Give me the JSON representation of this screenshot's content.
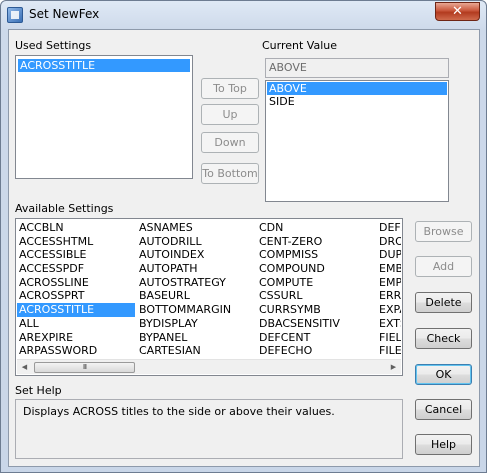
{
  "window": {
    "title": "Set NewFex",
    "close_glyph": "✕"
  },
  "used_settings": {
    "label": "Used Settings",
    "items": [
      "ACROSSTITLE"
    ]
  },
  "move_buttons": {
    "to_top": "To Top",
    "up": "Up",
    "down": "Down",
    "to_bottom": "To Bottom"
  },
  "current_value": {
    "label": "Current Value",
    "field_value": "ABOVE",
    "options": [
      "ABOVE",
      "SIDE"
    ]
  },
  "available_settings": {
    "label": "Available Settings",
    "columns": [
      [
        "ACCBLN",
        "ACCESSHTML",
        "ACCESSIBLE",
        "ACCESSPDF",
        "ACROSSLINE",
        "ACROSSPRT",
        "ACROSSTITLE",
        "ALL",
        "AREXPIRE",
        "ARPASSWORD"
      ],
      [
        "ASNAMES",
        "AUTODRILL",
        "AUTOINDEX",
        "AUTOPATH",
        "AUTOSTRATEGY",
        "BASEURL",
        "BOTTOMMARGIN",
        "BYDISPLAY",
        "BYPANEL",
        "CARTESIAN"
      ],
      [
        "CDN",
        "CENT-ZERO",
        "COMPMISS",
        "COMPOUND",
        "COMPUTE",
        "CSSURL",
        "CURRSYMB",
        "DBACSENSITIV",
        "DEFCENT",
        "DEFECHO"
      ],
      [
        "DEFI",
        "DRO",
        "DUPL",
        "EMBE",
        "EMPT",
        "ERRO",
        "EXPA",
        "EXTS",
        "FIELI",
        "FILEI"
      ]
    ],
    "scroll_left": "◀",
    "scroll_right": "▶",
    "thumb_grip": "III"
  },
  "side_buttons": {
    "browse": "Browse",
    "add": "Add",
    "delete": "Delete",
    "check": "Check",
    "ok": "OK",
    "cancel": "Cancel",
    "help": "Help"
  },
  "set_help": {
    "label": "Set Help",
    "text": "Displays ACROSS titles to the side or above their values."
  }
}
